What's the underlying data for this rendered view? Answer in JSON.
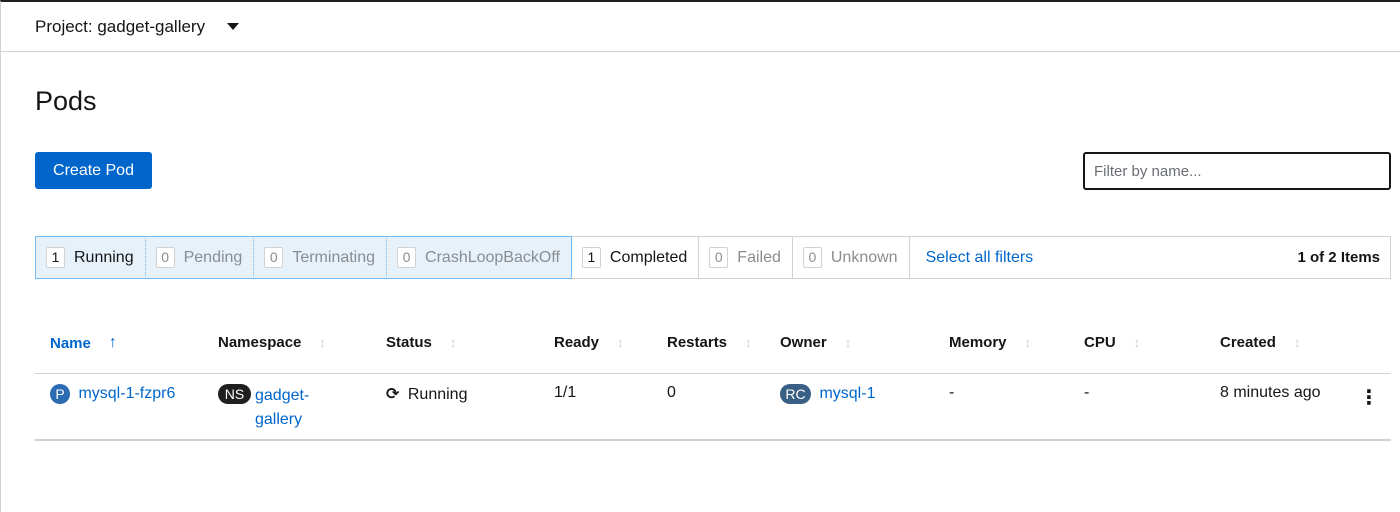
{
  "project": {
    "label": "Project: gadget-gallery"
  },
  "page": {
    "title": "Pods",
    "create_button": "Create Pod"
  },
  "filter": {
    "placeholder": "Filter by name..."
  },
  "status_filters": [
    {
      "count": "1",
      "label": "Running",
      "selected": true
    },
    {
      "count": "0",
      "label": "Pending",
      "selected": true
    },
    {
      "count": "0",
      "label": "Terminating",
      "selected": true
    },
    {
      "count": "0",
      "label": "CrashLoopBackOff",
      "selected": true
    },
    {
      "count": "1",
      "label": "Completed",
      "selected": false
    },
    {
      "count": "0",
      "label": "Failed",
      "selected": false
    },
    {
      "count": "0",
      "label": "Unknown",
      "selected": false
    }
  ],
  "select_all": "Select all filters",
  "item_count": "1 of 2 Items",
  "columns": [
    "Name",
    "Namespace",
    "Status",
    "Ready",
    "Restarts",
    "Owner",
    "Memory",
    "CPU",
    "Created"
  ],
  "rows": [
    {
      "name_badge": "P",
      "name": "mysql-1-fzpr6",
      "namespace_badge": "NS",
      "namespace_line1": "gadget-",
      "namespace_line2": "gallery",
      "status": "Running",
      "ready": "1/1",
      "restarts": "0",
      "owner_badge": "RC",
      "owner": "mysql-1",
      "memory": "-",
      "cpu": "-",
      "created": "8 minutes ago"
    }
  ],
  "icons": {
    "sort_asc": "sort-ascending-icon",
    "sort": "sort-icon",
    "status": "sync-icon",
    "kebab": "kebab-menu-icon"
  }
}
